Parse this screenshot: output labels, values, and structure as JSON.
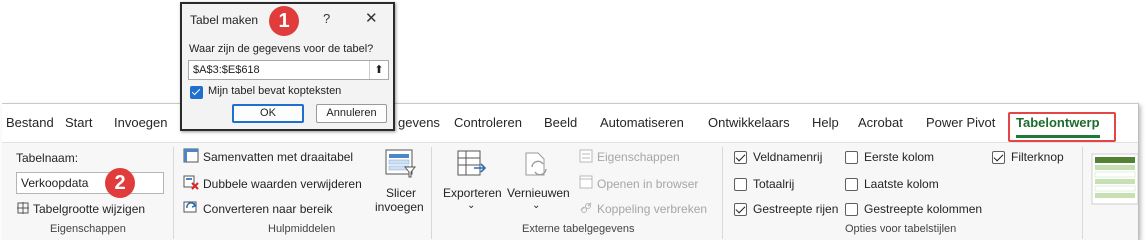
{
  "dialog": {
    "title": "Tabel maken",
    "help": "?",
    "close": "✕",
    "question": "Waar zijn de gegevens voor de tabel?",
    "range_value": "$A$3:$E$618",
    "collapse_glyph": "⬆",
    "has_headers_label": "Mijn tabel bevat kopteksten",
    "has_headers_checked": true,
    "ok_label": "OK",
    "cancel_label": "Annuleren"
  },
  "badges": {
    "one": "1",
    "two": "2"
  },
  "tabs": [
    {
      "label": "Bestand"
    },
    {
      "label": "Start"
    },
    {
      "label": "Invoegen"
    },
    {
      "label": "gevens"
    },
    {
      "label": "Controleren"
    },
    {
      "label": "Beeld"
    },
    {
      "label": "Automatiseren"
    },
    {
      "label": "Ontwikkelaars"
    },
    {
      "label": "Help"
    },
    {
      "label": "Acrobat"
    },
    {
      "label": "Power Pivot"
    },
    {
      "label": "Tabelontwerp",
      "active": true
    }
  ],
  "properties": {
    "name_label": "Tabelnaam:",
    "name_value": "Verkoopdata",
    "resize_label": "Tabelgrootte wijzigen",
    "group_title": "Eigenschappen"
  },
  "tools": {
    "pivot_label": "Samenvatten met draaitabel",
    "remove_dupes_label": "Dubbele waarden verwijderen",
    "convert_label": "Converteren naar bereik",
    "slicer_label_1": "Slicer",
    "slicer_label_2": "invoegen",
    "group_title": "Hulpmiddelen"
  },
  "external": {
    "export_label": "Exporteren",
    "refresh_label": "Vernieuwen",
    "properties_label": "Eigenschappen",
    "open_browser_label": "Openen in browser",
    "unlink_label": "Koppeling verbreken",
    "group_title": "Externe tabelgegevens"
  },
  "style_options": {
    "header_row": {
      "label": "Veldnamenrij",
      "checked": true
    },
    "total_row": {
      "label": "Totaalrij",
      "checked": false
    },
    "banded_rows": {
      "label": "Gestreepte rijen",
      "checked": true
    },
    "first_column": {
      "label": "Eerste kolom",
      "checked": false
    },
    "last_column": {
      "label": "Laatste kolom",
      "checked": false
    },
    "banded_columns": {
      "label": "Gestreepte kolommen",
      "checked": false
    },
    "filter_button": {
      "label": "Filterknop",
      "checked": true
    },
    "group_title": "Opties voor tabelstijlen"
  },
  "colors": {
    "accent_green": "#1e7b34",
    "badge_red": "#e13c3c",
    "highlight_red": "#e64545",
    "dialog_blue": "#1f6fd1"
  }
}
